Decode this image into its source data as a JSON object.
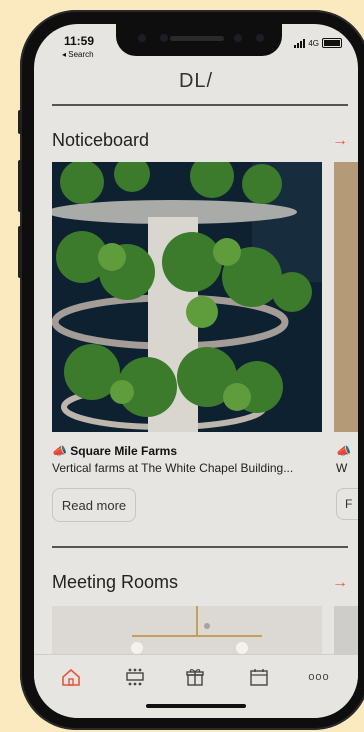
{
  "status": {
    "time": "11:59",
    "back_label": "◂ Search",
    "network": "4G"
  },
  "header": {
    "logo": "DL/"
  },
  "noticeboard": {
    "title": "Noticeboard",
    "arrow": "→",
    "card": {
      "title": "Square Mile Farms",
      "subtitle": "Vertical farms at The White Chapel Building...",
      "button_label": "Read more"
    },
    "peek_title_char": "W",
    "peek_button_char": "F"
  },
  "meeting_rooms": {
    "title": "Meeting Rooms",
    "arrow": "→"
  },
  "tabs": [
    {
      "name": "home",
      "icon": "home-icon"
    },
    {
      "name": "rooms",
      "icon": "meeting-room-icon"
    },
    {
      "name": "perks",
      "icon": "gift-icon"
    },
    {
      "name": "bookings",
      "icon": "calendar-icon"
    },
    {
      "name": "more",
      "icon": "more-icon",
      "label": "ooo"
    }
  ],
  "colors": {
    "accent": "#e2583a",
    "screen_bg": "#e6e5e2",
    "page_bg": "#fbe9bf"
  }
}
